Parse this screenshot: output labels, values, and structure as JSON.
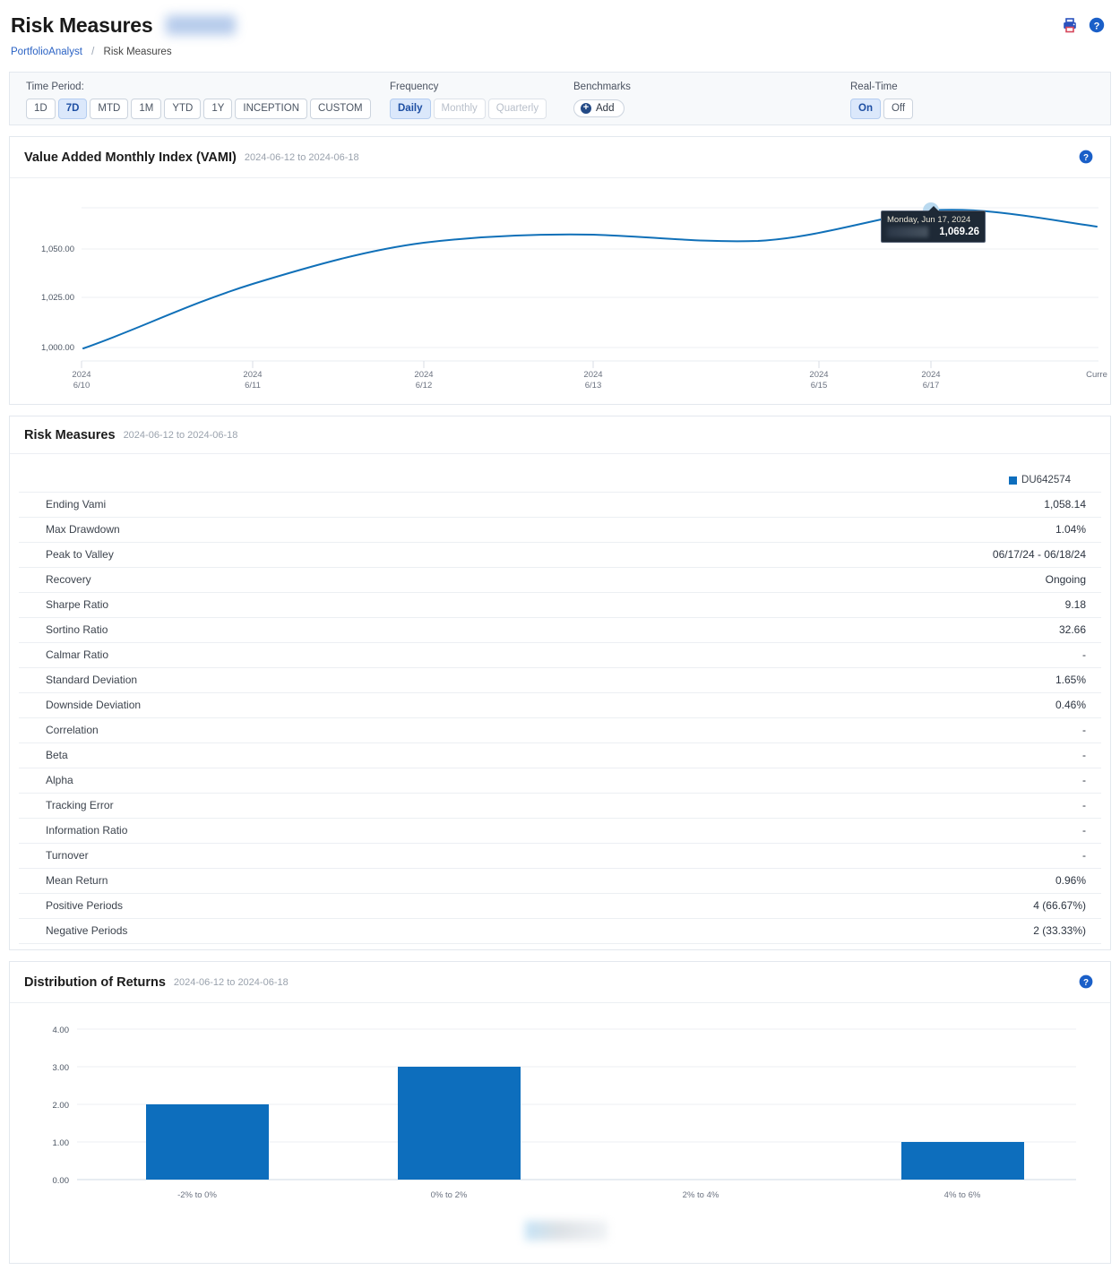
{
  "header": {
    "title": "Risk Measures",
    "redacted_badge": true,
    "print_icon": "printer-icon",
    "help_icon": "help-circle-icon"
  },
  "breadcrumb": {
    "root": "PortfolioAnalyst",
    "separator": "/",
    "current": "Risk Measures"
  },
  "toolbar": {
    "time_period": {
      "label": "Time Period:",
      "options": [
        "1D",
        "7D",
        "MTD",
        "1M",
        "YTD",
        "1Y",
        "INCEPTION",
        "CUSTOM"
      ],
      "selected": "7D"
    },
    "frequency": {
      "label": "Frequency",
      "options": [
        "Daily",
        "Monthly",
        "Quarterly"
      ],
      "selected": "Daily",
      "disabled": [
        "Monthly",
        "Quarterly"
      ]
    },
    "benchmarks": {
      "label": "Benchmarks",
      "add_label": "Add"
    },
    "realtime": {
      "label": "Real-Time",
      "options": [
        "On",
        "Off"
      ],
      "selected": "On"
    }
  },
  "vami_panel": {
    "title": "Value Added Monthly Index (VAMI)",
    "subtitle": "2024-06-12 to 2024-06-18",
    "help_icon": "help-circle-icon",
    "tooltip": {
      "date": "Monday, Jun 17, 2024",
      "value": "1,069.26",
      "series_label_redacted": true
    }
  },
  "risk_panel": {
    "title": "Risk Measures",
    "subtitle": "2024-06-12 to 2024-06-18",
    "column_header": "DU642574",
    "column_color": "#0d6ebd",
    "rows": [
      {
        "label": "Ending Vami",
        "value": "1,058.14"
      },
      {
        "label": "Max Drawdown",
        "value": "1.04%"
      },
      {
        "label": "Peak to Valley",
        "value": "06/17/24 - 06/18/24"
      },
      {
        "label": "Recovery",
        "value": "Ongoing"
      },
      {
        "label": "Sharpe Ratio",
        "value": "9.18"
      },
      {
        "label": "Sortino Ratio",
        "value": "32.66"
      },
      {
        "label": "Calmar Ratio",
        "value": "-"
      },
      {
        "label": "Standard Deviation",
        "value": "1.65%"
      },
      {
        "label": "Downside Deviation",
        "value": "0.46%"
      },
      {
        "label": "Correlation",
        "value": "-"
      },
      {
        "label": "Beta",
        "value": "-"
      },
      {
        "label": "Alpha",
        "value": "-"
      },
      {
        "label": "Tracking Error",
        "value": "-"
      },
      {
        "label": "Information Ratio",
        "value": "-"
      },
      {
        "label": "Turnover",
        "value": "-"
      },
      {
        "label": "Mean Return",
        "value": "0.96%"
      },
      {
        "label": "Positive Periods",
        "value": "4 (66.67%)"
      },
      {
        "label": "Negative Periods",
        "value": "2 (33.33%)"
      }
    ]
  },
  "dist_panel": {
    "title": "Distribution of Returns",
    "subtitle": "2024-06-12 to 2024-06-18",
    "help_icon": "help-circle-icon",
    "legend_redacted": true
  },
  "chart_data": [
    {
      "type": "line",
      "title": "Value Added Monthly Index (VAMI)",
      "subtitle": "2024-06-12 to 2024-06-18",
      "xlabel": "",
      "ylabel": "",
      "ylim": [
        995,
        1078
      ],
      "yticks": [
        1000,
        1025,
        1050
      ],
      "ytick_labels": [
        "1,000.00",
        "1,025.00",
        "1,050.00"
      ],
      "x_tick_labels": [
        [
          "2024",
          "6/10"
        ],
        [
          "2024",
          "6/11"
        ],
        [
          "2024",
          "6/12"
        ],
        [
          "2024",
          "6/13"
        ],
        [
          "2024",
          "6/15"
        ],
        [
          "2024",
          "6/17"
        ],
        [
          "Curre",
          ""
        ]
      ],
      "grid": true,
      "legend": "none",
      "series": [
        {
          "name": "DU642574",
          "color": "#1070b8",
          "x": [
            "6/10",
            "6/11",
            "6/12",
            "6/13",
            "6/14",
            "6/15",
            "6/17",
            "6/18",
            "Current"
          ],
          "values": [
            1000.0,
            1027.5,
            1052.0,
            1061.5,
            1062.0,
            1059.5,
            1069.26,
            1063.5,
            1058.14
          ]
        }
      ],
      "highlight_point": {
        "x": "6/17",
        "y": 1069.26,
        "label": "Monday, Jun 17, 2024"
      }
    },
    {
      "type": "bar",
      "title": "Distribution of Returns",
      "subtitle": "2024-06-12 to 2024-06-18",
      "categories": [
        "-2% to 0%",
        "0% to 2%",
        "2% to 4%",
        "4% to 6%"
      ],
      "values": [
        2,
        3,
        0,
        1
      ],
      "bar_color": "#0d6ebd",
      "xlabel": "",
      "ylabel": "",
      "ylim": [
        0,
        4
      ],
      "yticks": [
        0,
        1,
        2,
        3,
        4
      ],
      "ytick_labels": [
        "0.00",
        "1.00",
        "2.00",
        "3.00",
        "4.00"
      ],
      "grid": true,
      "legend": "bottom"
    }
  ]
}
